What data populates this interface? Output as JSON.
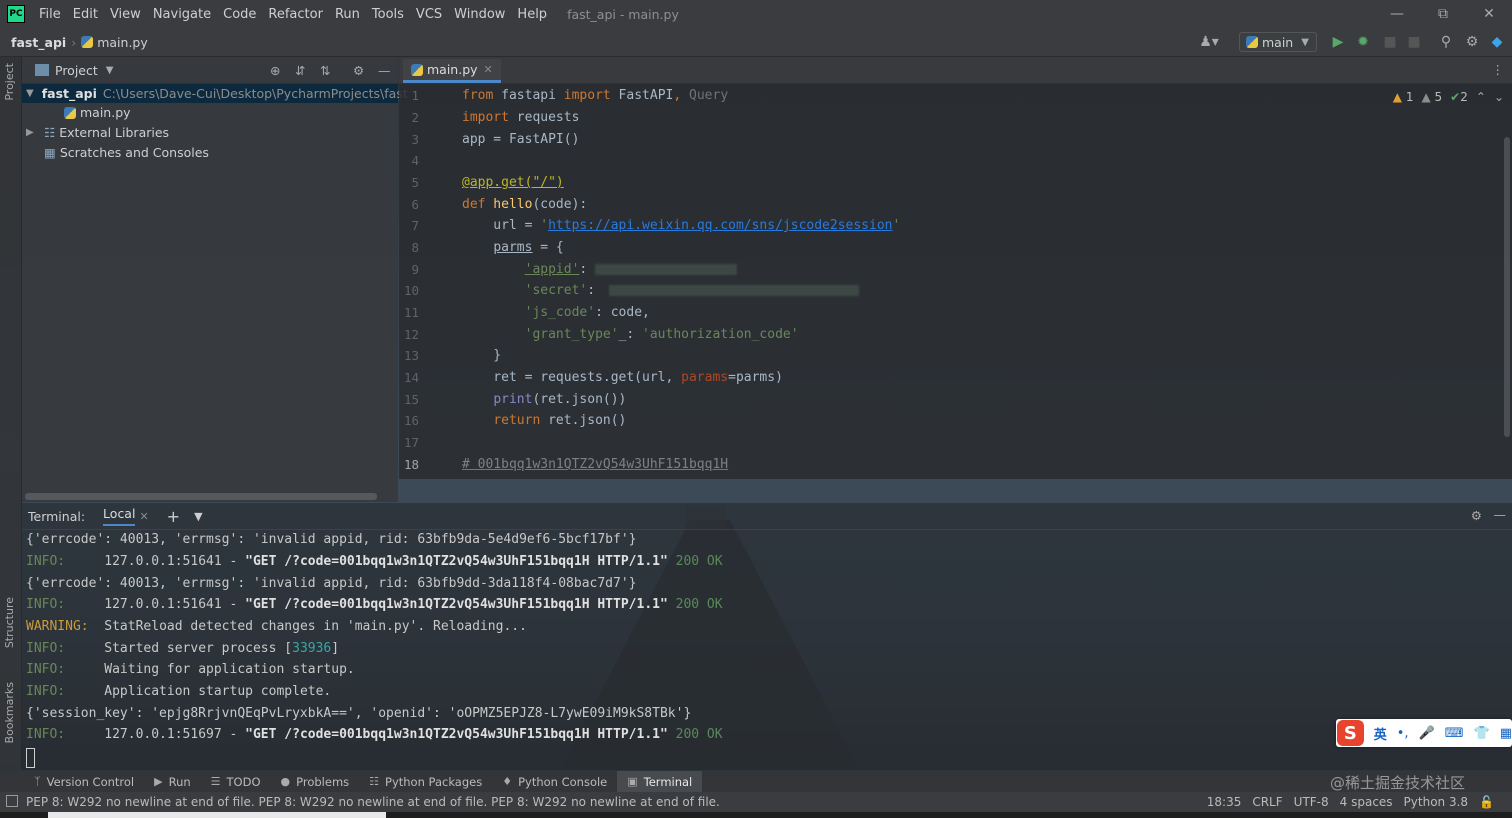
{
  "menubar": {
    "logo": "PC",
    "items": [
      "File",
      "Edit",
      "View",
      "Navigate",
      "Code",
      "Refactor",
      "Run",
      "Tools",
      "VCS",
      "Window",
      "Help"
    ],
    "window_title": "fast_api - main.py"
  },
  "navbar": {
    "project": "fast_api",
    "file": "main.py",
    "run_config": "main"
  },
  "left_stripe": {
    "project": "Project",
    "structure": "Structure",
    "bookmarks": "Bookmarks"
  },
  "project_panel": {
    "title": "Project",
    "tree": [
      {
        "label": "fast_api",
        "path": "C:\\Users\\Dave-Cui\\Desktop\\PycharmProjects\\fast",
        "selected": true
      },
      {
        "label": "main.py"
      },
      {
        "label": "External Libraries"
      },
      {
        "label": "Scratches and Consoles"
      }
    ]
  },
  "editor": {
    "tab": "main.py",
    "inspections": {
      "warnings": "1",
      "weak_warnings": "5",
      "ok": "2"
    },
    "line_numbers": [
      "1",
      "2",
      "3",
      "4",
      "5",
      "6",
      "7",
      "8",
      "9",
      "10",
      "11",
      "12",
      "13",
      "14",
      "15",
      "16",
      "17",
      "18"
    ],
    "code": {
      "l1_from": "from",
      "l1_mod": " fastapi ",
      "l1_import": "import",
      "l1_names": " FastAPI",
      "l1_comma": ",",
      "l1_query": " Query",
      "l2_import": "import",
      "l2_rest": " requests",
      "l3": "app = FastAPI()",
      "l5_deco": "@app.get(\"/\")",
      "l6_def": "def",
      "l6_fn": " hello",
      "l6_rest": "(code):",
      "l7_pre": "    url = ",
      "l7_q1": "'",
      "l7_url": "https://api.weixin.qq.com/sns/jscode2session",
      "l7_q2": "'",
      "l8_pre": "    ",
      "l8_var": "parms",
      "l8_rest": " = {",
      "l9_pre": "        ",
      "l9_key": "'appid'",
      "l9_colon": ": ",
      "l10_pre": "        ",
      "l10_key": "'secret'",
      "l10_colon": ": ",
      "l11_pre": "        ",
      "l11_key": "'js_code'",
      "l11_rest": ": code,",
      "l12_pre": "        ",
      "l12_key": "'grant_type'",
      "l12_mid": "_: ",
      "l12_val": "'authorization_code'",
      "l13": "    }",
      "l14_pre": "    ret = requests.get(url, ",
      "l14_param": "params",
      "l14_rest": "=parms)",
      "l15_pre": "    ",
      "l15_print": "print",
      "l15_rest": "(ret.json())",
      "l16_pre": "    ",
      "l16_return": "return",
      "l16_rest": " ret.json()",
      "l18_comment": "# 001bqq1w3n1QTZ2vQ54w3UhF151bqq1H"
    }
  },
  "terminal": {
    "label": "Terminal:",
    "tab": "Local",
    "lines": {
      "l1": "{'errcode': 40013, 'errmsg': 'invalid appid, rid: 63bfb9da-5e4d9ef6-5bcf17bf'}",
      "l2_tag": "INFO:",
      "l2_addr": "     127.0.0.1:51641 - ",
      "l2_req": "\"GET /?code=001bqq1w3n1QTZ2vQ54w3UhF151bqq1H HTTP/1.1\"",
      "l2_status": " 200 OK",
      "l3": "{'errcode': 40013, 'errmsg': 'invalid appid, rid: 63bfb9dd-3da118f4-08bac7d7'}",
      "l4_tag": "INFO:",
      "l4_addr": "     127.0.0.1:51641 - ",
      "l4_req": "\"GET /?code=001bqq1w3n1QTZ2vQ54w3UhF151bqq1H HTTP/1.1\"",
      "l4_status": " 200 OK",
      "l5_tag": "WARNING:",
      "l5_msg": "  StatReload detected changes in 'main.py'. Reloading...",
      "l6_tag": "INFO:",
      "l6_msg": "     Started server process [",
      "l6_pid": "33936",
      "l6_end": "]",
      "l7_tag": "INFO:",
      "l7_msg": "     Waiting for application startup.",
      "l8_tag": "INFO:",
      "l8_msg": "     Application startup complete.",
      "l9": "{'session_key': 'epjg8RrjvnQEqPvLryxbkA==', 'openid': 'oOPMZ5EPJZ8-L7ywE09iM9kS8TBk'}",
      "l10_tag": "INFO:",
      "l10_addr": "     127.0.0.1:51697 - ",
      "l10_req": "\"GET /?code=001bqq1w3n1QTZ2vQ54w3UhF151bqq1H HTTP/1.1\"",
      "l10_status": " 200 OK"
    }
  },
  "tool_tabs": [
    "Version Control",
    "Run",
    "TODO",
    "Problems",
    "Python Packages",
    "Python Console",
    "Terminal"
  ],
  "statusbar": {
    "message": "PEP 8: W292 no newline at end of file. PEP 8: W292 no newline at end of file. PEP 8: W292 no newline at end of file.",
    "position": "18:35",
    "line_sep": "CRLF",
    "encoding": "UTF-8",
    "indent": "4 spaces",
    "interpreter": "Python 3.8"
  },
  "ime": {
    "logo": "S",
    "mode": "英",
    "punct": "•,",
    "mic": "🎤",
    "keyboard": "⌨",
    "skin": "👕",
    "tools": "▦"
  },
  "watermark": "@稀土掘金技术社区",
  "colors": {
    "accent": "#4a88c7",
    "keyword": "#cc7832",
    "string": "#6a8759",
    "link": "#287bde"
  }
}
